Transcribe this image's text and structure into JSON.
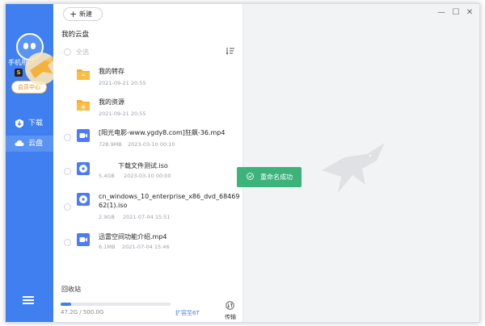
{
  "sidebar": {
    "user_name": "手机用户",
    "level_badge": "S",
    "vip_label": "会员中心",
    "nav": [
      {
        "label": "下载",
        "icon": "download-shield-icon"
      },
      {
        "label": "云盘",
        "icon": "cloud-icon"
      }
    ]
  },
  "toolbar": {
    "new_label": "新建"
  },
  "panel": {
    "title": "我的云盘",
    "select_all": "全选"
  },
  "files": [
    {
      "name": "我的转存",
      "size": "",
      "date": "2021-09-21 20:55",
      "type": "folder"
    },
    {
      "name": "我的资源",
      "size": "",
      "date": "2021-09-21 20:55",
      "type": "folder"
    },
    {
      "name": "[阳光电影-www.ygdy8.com]狂飙-36.mp4",
      "size": "728.9MB",
      "date": "2023-03-10 00:10",
      "type": "video"
    },
    {
      "name": "下载文件测试.iso",
      "size": "5.4GB",
      "date": "2023-03-10 00:00",
      "type": "iso"
    },
    {
      "name_line1": "cn_windows_10_enterprise_x86_dvd_68469",
      "name_line2": "62(1).iso",
      "size": "2.9GB",
      "date": "2021-07-04 15:51",
      "type": "iso"
    },
    {
      "name": "迅雷空间功能介绍.mp4",
      "size": "6.1MB",
      "date": "2021-07-04 15:46",
      "type": "video"
    }
  ],
  "footer": {
    "recycle_bin": "回收站",
    "storage_text": "47.2G / 500.0G",
    "storage_used_fraction": 0.094,
    "expand_link": "扩容至6T",
    "transfer_label": "传输"
  },
  "toast": {
    "message": "重命名成功"
  },
  "colors": {
    "accent": "#3f7ff0",
    "toast": "#3db37c",
    "folder": "#f6ad2d",
    "video": "#4d7bf5"
  }
}
